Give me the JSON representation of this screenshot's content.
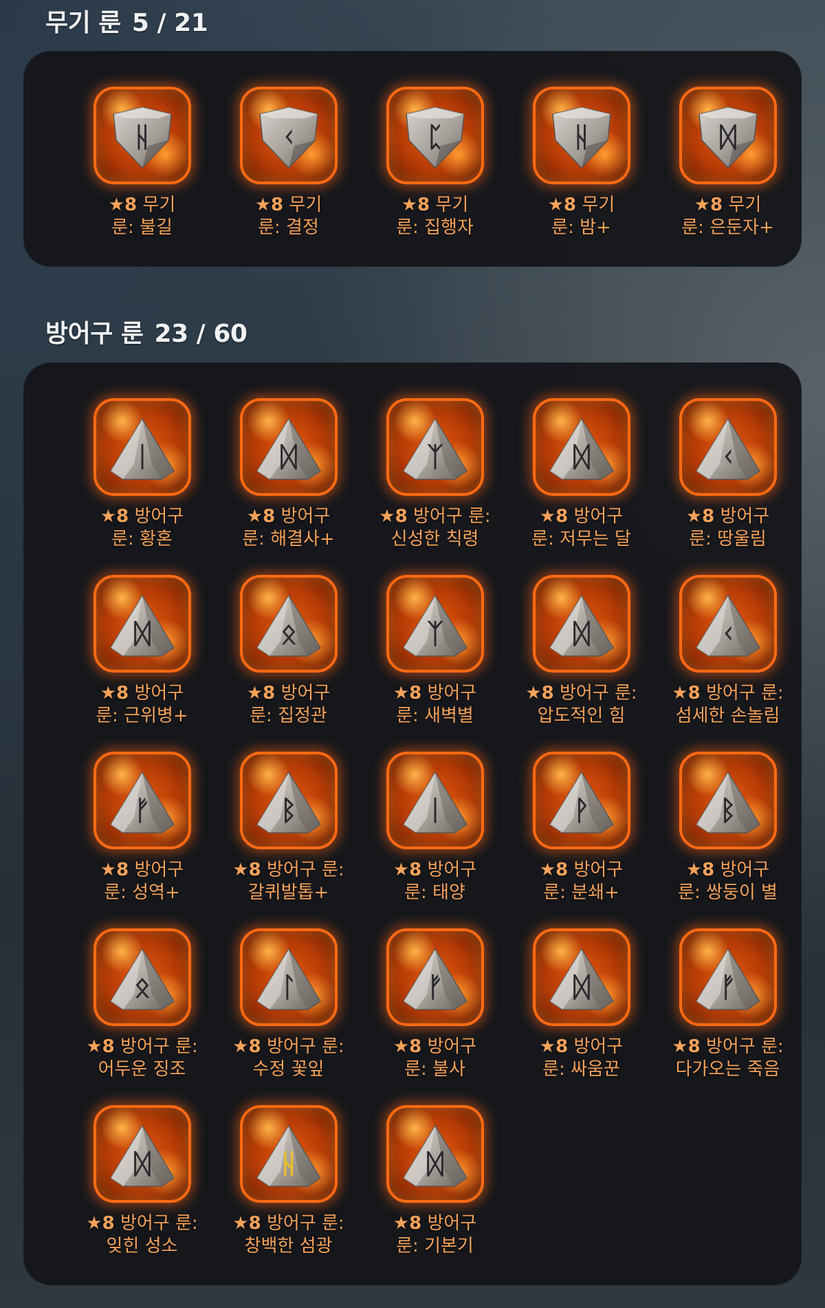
{
  "weapon_section": {
    "title": "무기 룬",
    "count": "5 / 21",
    "items": [
      {
        "star": "★",
        "grade": "8",
        "line1": "무기",
        "line2": "룬: 불길",
        "glyph": "ᚺ",
        "shape": "shield"
      },
      {
        "star": "★",
        "grade": "8",
        "line1": "무기",
        "line2": "룬: 결정",
        "glyph": "ᚲ",
        "shape": "shield"
      },
      {
        "star": "★",
        "grade": "8",
        "line1": "무기",
        "line2": "룬: 집행자",
        "glyph": "ᛈ",
        "shape": "shield"
      },
      {
        "star": "★",
        "grade": "8",
        "line1": "무기",
        "line2": "룬: 밤+",
        "glyph": "ᚺ",
        "shape": "shield"
      },
      {
        "star": "★",
        "grade": "8",
        "line1": "무기",
        "line2": "룬: 은둔자+",
        "glyph": "ᛞ",
        "shape": "shield"
      }
    ]
  },
  "armor_section": {
    "title": "방어구 룬",
    "count": "23 / 60",
    "items": [
      {
        "star": "★",
        "grade": "8",
        "line1": "방어구",
        "line2": "룬: 황혼",
        "glyph": "ᛁ",
        "shape": "pyramid"
      },
      {
        "star": "★",
        "grade": "8",
        "line1": "방어구",
        "line2": "룬: 해결사+",
        "glyph": "ᛞ",
        "shape": "pyramid"
      },
      {
        "star": "★",
        "grade": "8",
        "line1": "방어구 룬:",
        "line2": "신성한 칙령",
        "glyph": "ᛉ",
        "shape": "pyramid"
      },
      {
        "star": "★",
        "grade": "8",
        "line1": "방어구",
        "line2": "룬: 저무는 달",
        "glyph": "ᛞ",
        "shape": "pyramid"
      },
      {
        "star": "★",
        "grade": "8",
        "line1": "방어구",
        "line2": "룬: 땅울림",
        "glyph": "ᚲ",
        "shape": "pyramid"
      },
      {
        "star": "★",
        "grade": "8",
        "line1": "방어구",
        "line2": "룬: 근위병+",
        "glyph": "ᛞ",
        "shape": "pyramid"
      },
      {
        "star": "★",
        "grade": "8",
        "line1": "방어구",
        "line2": "룬: 집정관",
        "glyph": "ᛟ",
        "shape": "pyramid"
      },
      {
        "star": "★",
        "grade": "8",
        "line1": "방어구",
        "line2": "룬: 새벽별",
        "glyph": "ᛉ",
        "shape": "pyramid"
      },
      {
        "star": "★",
        "grade": "8",
        "line1": "방어구 룬:",
        "line2": "압도적인 힘",
        "glyph": "ᛞ",
        "shape": "pyramid"
      },
      {
        "star": "★",
        "grade": "8",
        "line1": "방어구 룬:",
        "line2": "섬세한 손놀림",
        "glyph": "ᚲ",
        "shape": "pyramid"
      },
      {
        "star": "★",
        "grade": "8",
        "line1": "방어구",
        "line2": "룬: 성역+",
        "glyph": "ᚠ",
        "shape": "pyramid"
      },
      {
        "star": "★",
        "grade": "8",
        "line1": "방어구 룬:",
        "line2": "갈퀴발톱+",
        "glyph": "ᛒ",
        "shape": "pyramid"
      },
      {
        "star": "★",
        "grade": "8",
        "line1": "방어구",
        "line2": "룬: 태양",
        "glyph": "ᛁ",
        "shape": "pyramid"
      },
      {
        "star": "★",
        "grade": "8",
        "line1": "방어구",
        "line2": "룬: 분쇄+",
        "glyph": "ᚹ",
        "shape": "pyramid"
      },
      {
        "star": "★",
        "grade": "8",
        "line1": "방어구",
        "line2": "룬: 쌍둥이 별",
        "glyph": "ᛒ",
        "shape": "pyramid"
      },
      {
        "star": "★",
        "grade": "8",
        "line1": "방어구 룬:",
        "line2": "어두운 징조",
        "glyph": "ᛟ",
        "shape": "pyramid"
      },
      {
        "star": "★",
        "grade": "8",
        "line1": "방어구 룬:",
        "line2": "수정 꽃잎",
        "glyph": "ᛚ",
        "shape": "pyramid"
      },
      {
        "star": "★",
        "grade": "8",
        "line1": "방어구",
        "line2": "룬: 불사",
        "glyph": "ᚠ",
        "shape": "pyramid"
      },
      {
        "star": "★",
        "grade": "8",
        "line1": "방어구",
        "line2": "룬: 싸움꾼",
        "glyph": "ᛞ",
        "shape": "pyramid"
      },
      {
        "star": "★",
        "grade": "8",
        "line1": "방어구 룬:",
        "line2": "다가오는 죽음",
        "glyph": "ᚠ",
        "shape": "pyramid"
      },
      {
        "star": "★",
        "grade": "8",
        "line1": "방어구 룬:",
        "line2": "잊힌 성소",
        "glyph": "ᛞ",
        "shape": "pyramid"
      },
      {
        "star": "★",
        "grade": "8",
        "line1": "방어구 룬:",
        "line2": "창백한 섬광",
        "glyph": "ᚺ",
        "shape": "pyramid",
        "glyph_color": "#f0c020"
      },
      {
        "star": "★",
        "grade": "8",
        "line1": "방어구",
        "line2": "룬: 기본기",
        "glyph": "ᛞ",
        "shape": "pyramid"
      }
    ]
  },
  "colors": {
    "accent_orange": "#ff6a13",
    "label_orange": "#f4a25a",
    "glyph_dark": "#2a2a2e",
    "glyph_gold": "#f0c020"
  }
}
